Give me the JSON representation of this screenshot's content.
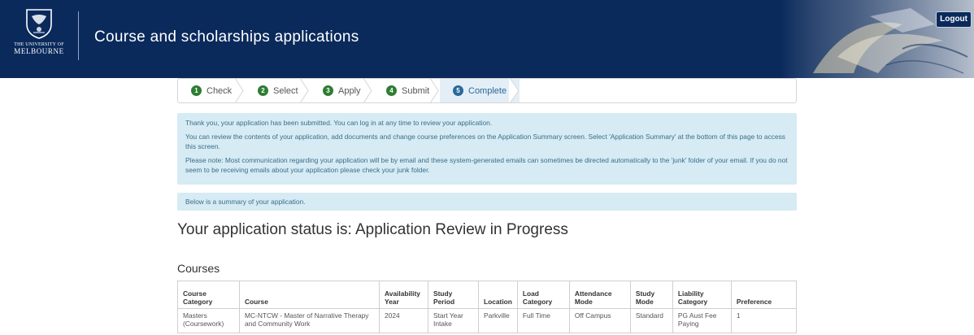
{
  "header": {
    "university_line1": "THE UNIVERSITY OF",
    "university_line2": "MELBOURNE",
    "title": "Course and scholarships applications",
    "logout_label": "Logout"
  },
  "steps": [
    {
      "num": "1",
      "label": "Check"
    },
    {
      "num": "2",
      "label": "Select"
    },
    {
      "num": "3",
      "label": "Apply"
    },
    {
      "num": "4",
      "label": "Submit"
    },
    {
      "num": "5",
      "label": "Complete"
    }
  ],
  "active_step": "Complete",
  "info": {
    "para1": "Thank you, your application has been submitted. You can log in at any time to review your application.",
    "para2": "You can review the contents of your application, add documents and change course preferences on the Application Summary screen. Select 'Application Summary' at the bottom of this page to access this screen.",
    "para3": "Please note: Most communication regarding your application will be by email and these system-generated emails can sometimes be directed automatically to the 'junk' folder of your email. If you do not seem to be receiving emails about your application please check your junk folder.",
    "summary": "Below is a summary of your application."
  },
  "status_heading": "Your application status is: Application Review in Progress",
  "courses": {
    "heading": "Courses",
    "columns": [
      "Course Category",
      "Course",
      "Availability Year",
      "Study Period",
      "Location",
      "Load Category",
      "Attendance Mode",
      "Study Mode",
      "Liability Category",
      "Preference"
    ],
    "rows": [
      [
        "Masters (Coursework)",
        "MC-NTCW - Master of Narrative Therapy and Community Work",
        "2024",
        "Start Year Intake",
        "Parkville",
        "Full Time",
        "Off Campus",
        "Standard",
        "PG Aust Fee Paying",
        "1"
      ]
    ]
  },
  "colors": {
    "header_bg": "#0a2a5c",
    "info_bg": "#d6ebf4",
    "step_done": "#2e7d32",
    "step_active": "#2a6a9a"
  }
}
